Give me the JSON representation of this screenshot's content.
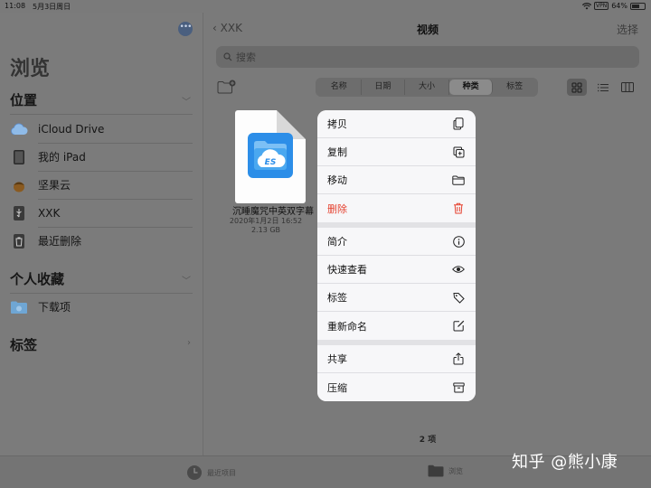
{
  "status": {
    "time": "11:08",
    "date": "5月3日周日",
    "vpn": "VPN",
    "battery": "64%",
    "battery_level": 0.64
  },
  "sidebar": {
    "title": "浏览",
    "sections": {
      "locations": {
        "label": "位置"
      },
      "favorites": {
        "label": "个人收藏"
      },
      "tags": {
        "label": "标签"
      }
    },
    "locations": [
      {
        "label": "iCloud Drive",
        "icon": "icloud-icon"
      },
      {
        "label": "我的 iPad",
        "icon": "ipad-icon"
      },
      {
        "label": "坚果云",
        "icon": "nut-icon"
      },
      {
        "label": "XXK",
        "icon": "usb-icon"
      },
      {
        "label": "最近删除",
        "icon": "trash-icon"
      }
    ],
    "favorites": [
      {
        "label": "下载项",
        "icon": "folder-download-icon"
      }
    ]
  },
  "nav": {
    "back": "XXK",
    "title": "视频",
    "select": "选择"
  },
  "search": {
    "placeholder": "搜索"
  },
  "sort": {
    "options": [
      "名称",
      "日期",
      "大小",
      "种类",
      "标签"
    ],
    "active": "种类"
  },
  "file": {
    "name": "沉睡魔咒中英双字幕",
    "date": "2020年1月2日 16:52",
    "size": "2.13 GB",
    "icon_text": "ES"
  },
  "menu": {
    "groups": [
      [
        {
          "label": "拷贝",
          "icon": "copy-icon"
        },
        {
          "label": "复制",
          "icon": "duplicate-icon"
        },
        {
          "label": "移动",
          "icon": "folder-icon"
        },
        {
          "label": "删除",
          "icon": "trash-icon",
          "danger": true
        }
      ],
      [
        {
          "label": "简介",
          "icon": "info-icon"
        },
        {
          "label": "快速查看",
          "icon": "eye-icon"
        },
        {
          "label": "标签",
          "icon": "tag-icon"
        },
        {
          "label": "重新命名",
          "icon": "edit-icon"
        }
      ],
      [
        {
          "label": "共享",
          "icon": "share-icon"
        },
        {
          "label": "压缩",
          "icon": "archive-icon"
        }
      ]
    ]
  },
  "footer": {
    "count": "2 项"
  },
  "tabbar": {
    "recent": "最近项目",
    "browse": "浏览"
  },
  "watermark": "知乎 @熊小康",
  "colors": {
    "accent_blue": "#2c8ee8",
    "danger": "#e5412f"
  }
}
